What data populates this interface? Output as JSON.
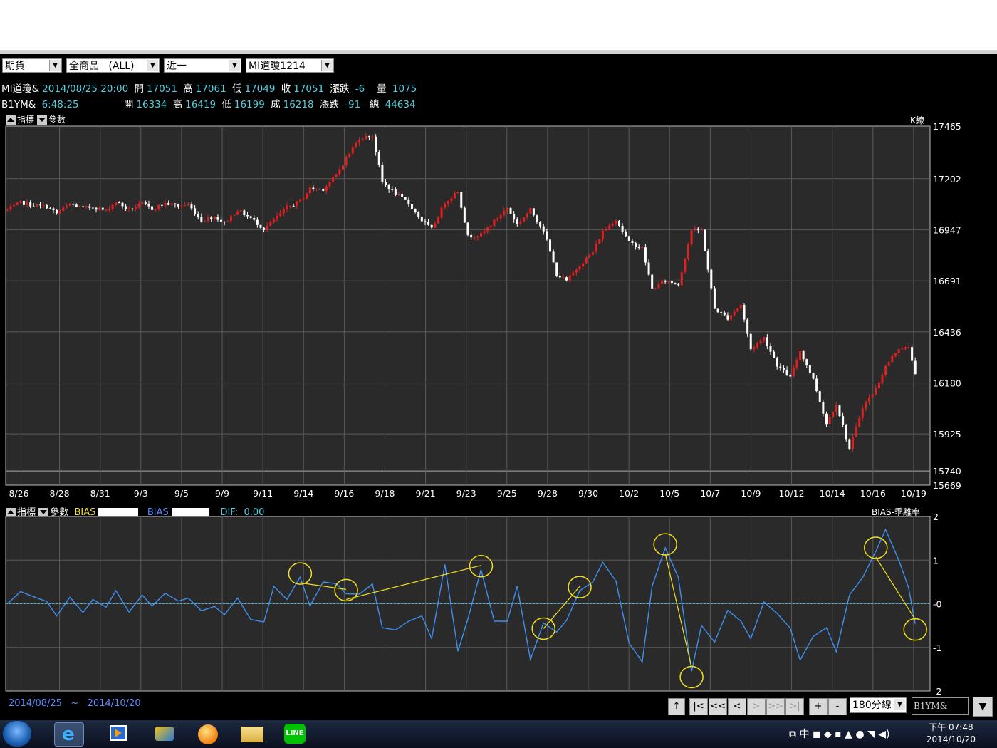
{
  "toolbar": {
    "market": "期貨",
    "product": "全商品",
    "product_scope": "(ALL)",
    "month": "近一",
    "contract": "MI道瓊1214"
  },
  "quote1": {
    "symbol": "MI道瓊&",
    "datetime": "2014/08/25 20:00",
    "open_label": "開",
    "open": "17051",
    "high_label": "高",
    "high": "17061",
    "low_label": "低",
    "low": "17049",
    "close_label": "收",
    "close": "17051",
    "chg_label": "漲跌",
    "chg": "-6",
    "vol_label": "量",
    "vol": "1075"
  },
  "quote2": {
    "symbol": "B1YM&",
    "time": "6:48:25",
    "open_label": "開",
    "open": "16334",
    "high_label": "高",
    "high": "16419",
    "low_label": "低",
    "low": "16199",
    "close_label": "成",
    "close": "16218",
    "chg_label": "漲跌",
    "chg": "-91",
    "vol_label": "總",
    "vol": "44634"
  },
  "panel1": {
    "tab_indicator": "指標",
    "tab_param": "參數",
    "name": "K線"
  },
  "panel2": {
    "tab_indicator": "指標",
    "tab_param": "參數",
    "bias1_label": "BIAS",
    "bias2_label": "BIAS",
    "dif_label": "DIF:",
    "dif_value": "0.00",
    "name": "BIAS-乖離率"
  },
  "footer": {
    "start": "2014/08/25",
    "sep": "~",
    "end": "2014/10/20",
    "interval": "180分線",
    "symbol_input": "B1YM&"
  },
  "nav_buttons": [
    "↑",
    "|<",
    "<<",
    "<",
    ">",
    ">>",
    ">|",
    "+",
    "-"
  ],
  "clock": {
    "ampm": "下午 07:48",
    "date": "2014/10/20"
  },
  "colors": {
    "up": "#e02020",
    "down": "#ffffff",
    "bias_line": "#3f8ff0",
    "zero_line": "#3fb8e0",
    "annotation": "#f0e020",
    "grid": "#5a5a5a",
    "plot_bg": "#2a2a2a"
  },
  "chart_data": [
    {
      "type": "candlestick",
      "y_ticks": [
        17465,
        17202,
        16947,
        16691,
        16436,
        16180,
        15925,
        15740,
        15669
      ],
      "ylim": [
        15669,
        17465
      ],
      "x_tick_labels": [
        "8/26",
        "8/28",
        "8/31",
        "9/3",
        "9/5",
        "9/9",
        "9/11",
        "9/14",
        "9/16",
        "9/18",
        "9/21",
        "9/23",
        "9/25",
        "9/28",
        "9/30",
        "10/2",
        "10/5",
        "10/7",
        "10/9",
        "10/12",
        "10/14",
        "10/16",
        "10/19"
      ],
      "close_path": [
        [
          0,
          17046
        ],
        [
          4,
          17082
        ],
        [
          8,
          17068
        ],
        [
          12,
          17062
        ],
        [
          15,
          17028
        ],
        [
          19,
          17075
        ],
        [
          23,
          17054
        ],
        [
          26,
          17061
        ],
        [
          30,
          17041
        ],
        [
          33,
          17087
        ],
        [
          37,
          17045
        ],
        [
          41,
          17077
        ],
        [
          44,
          17051
        ],
        [
          48,
          17078
        ],
        [
          52,
          17066
        ],
        [
          55,
          17071
        ],
        [
          59,
          16994
        ],
        [
          63,
          17013
        ],
        [
          66,
          16980
        ],
        [
          70,
          17045
        ],
        [
          74,
          17004
        ],
        [
          78,
          16951
        ],
        [
          81,
          16995
        ],
        [
          85,
          17057
        ],
        [
          89,
          17090
        ],
        [
          92,
          17152
        ],
        [
          96,
          17150
        ],
        [
          100,
          17220
        ],
        [
          103,
          17305
        ],
        [
          107,
          17404
        ],
        [
          111,
          17416
        ],
        [
          114,
          17185
        ],
        [
          118,
          17126
        ],
        [
          122,
          17079
        ],
        [
          126,
          16993
        ],
        [
          129,
          16949
        ],
        [
          133,
          17082
        ],
        [
          137,
          17141
        ],
        [
          140,
          16913
        ],
        [
          144,
          16922
        ],
        [
          148,
          16989
        ],
        [
          152,
          17056
        ],
        [
          155,
          16974
        ],
        [
          159,
          17046
        ],
        [
          163,
          16945
        ],
        [
          167,
          16724
        ],
        [
          170,
          16690
        ],
        [
          174,
          16771
        ],
        [
          178,
          16835
        ],
        [
          181,
          16938
        ],
        [
          185,
          16998
        ],
        [
          189,
          16883
        ],
        [
          193,
          16853
        ],
        [
          196,
          16651
        ],
        [
          200,
          16692
        ],
        [
          204,
          16672
        ],
        [
          208,
          16945
        ],
        [
          211,
          16944
        ],
        [
          215,
          16551
        ],
        [
          219,
          16505
        ],
        [
          223,
          16571
        ],
        [
          226,
          16349
        ],
        [
          230,
          16407
        ],
        [
          234,
          16270
        ],
        [
          238,
          16207
        ],
        [
          241,
          16341
        ],
        [
          245,
          16198
        ],
        [
          249,
          15977
        ],
        [
          252,
          16076
        ],
        [
          256,
          15850
        ],
        [
          260,
          16060
        ],
        [
          264,
          16150
        ],
        [
          267,
          16262
        ],
        [
          271,
          16356
        ],
        [
          274,
          16354
        ],
        [
          276,
          16232
        ]
      ]
    },
    {
      "type": "line",
      "name": "BIAS",
      "y_ticks": [
        2,
        1,
        0,
        -1,
        -2
      ],
      "ylim": [
        -2,
        2
      ],
      "x": [
        0,
        4,
        8,
        12,
        15,
        19,
        23,
        26,
        30,
        33,
        37,
        41,
        44,
        48,
        52,
        55,
        59,
        63,
        66,
        70,
        74,
        78,
        81,
        85,
        89,
        92,
        96,
        100,
        103,
        107,
        111,
        114,
        118,
        122,
        126,
        129,
        133,
        137,
        140,
        144,
        148,
        152,
        155,
        159,
        163,
        167,
        170,
        174,
        178,
        181,
        185,
        189,
        193,
        196,
        200,
        204,
        208,
        211,
        215,
        219,
        223,
        226,
        230,
        234,
        238,
        241,
        245,
        249,
        252,
        256,
        260,
        264,
        267,
        271,
        274,
        276
      ],
      "values": [
        0.0,
        0.28,
        0.16,
        0.05,
        -0.28,
        0.15,
        -0.2,
        0.1,
        -0.08,
        0.3,
        -0.19,
        0.2,
        -0.05,
        0.24,
        0.06,
        0.13,
        -0.16,
        -0.06,
        -0.25,
        0.13,
        -0.36,
        -0.42,
        0.4,
        0.1,
        0.61,
        -0.05,
        0.5,
        0.46,
        0.23,
        0.22,
        0.45,
        -0.55,
        -0.6,
        -0.4,
        -0.28,
        -0.8,
        0.9,
        -1.09,
        -0.35,
        0.78,
        -0.4,
        -0.4,
        0.4,
        -1.28,
        -0.44,
        -0.65,
        -0.38,
        0.3,
        0.5,
        0.95,
        0.52,
        -0.9,
        -1.33,
        0.4,
        1.28,
        0.6,
        -1.55,
        -0.5,
        -0.88,
        -0.15,
        -0.4,
        -0.8,
        0.04,
        -0.22,
        -0.56,
        -1.29,
        -0.75,
        -0.55,
        -1.1,
        0.2,
        0.6,
        1.2,
        1.7,
        1.0,
        0.36,
        -0.46
      ]
    }
  ]
}
